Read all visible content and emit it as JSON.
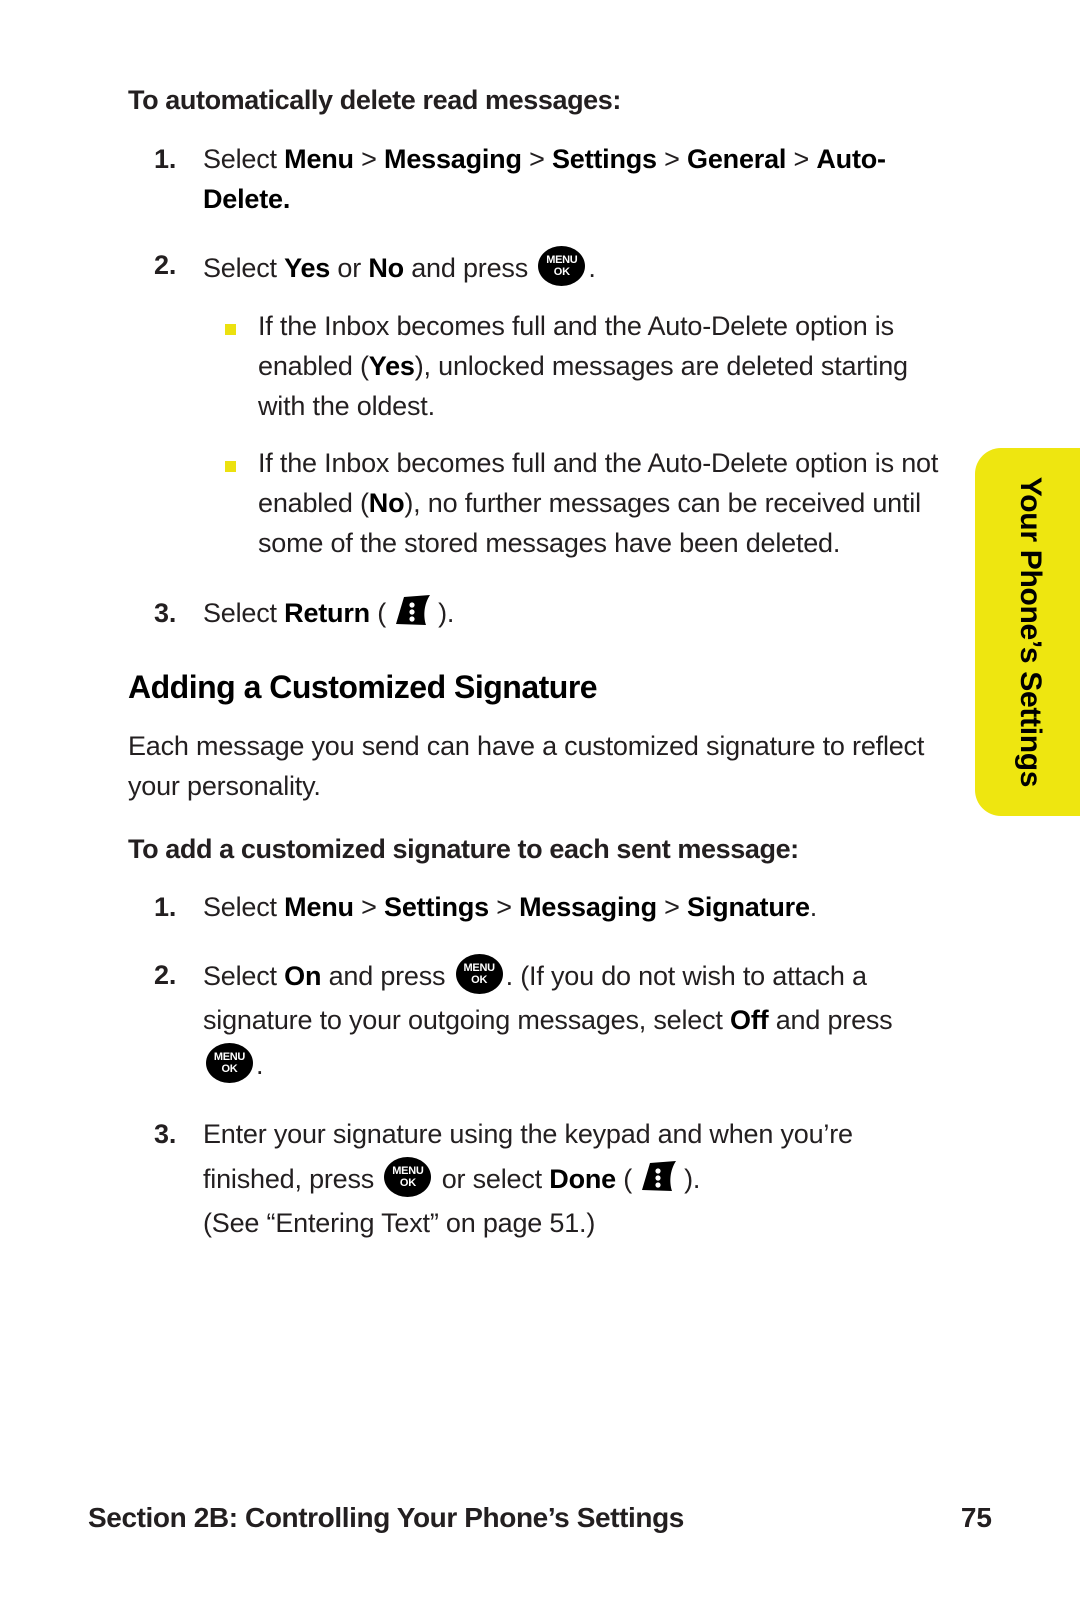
{
  "page": {
    "number": "75",
    "side_tab_label": "Your Phone’s Settings",
    "footer_title": "Section 2B: Controlling Your Phone’s Settings"
  },
  "proc1": {
    "heading": "To automatically delete read messages:",
    "steps": [
      {
        "num": "1.",
        "pre": "Select ",
        "bold1": "Menu",
        "sep1": " > ",
        "bold2": "Messaging",
        "sep2": " > ",
        "bold3": "Settings",
        "sep3": " > ",
        "bold4": "General",
        "sep4": " > ",
        "bold5": "Auto-Delete.",
        "post": ""
      },
      {
        "num": "2.",
        "pre": "Select ",
        "bold1": "Yes",
        "sep1": " or ",
        "bold2": "No",
        "post": " and press ",
        "icon": "menu-ok-button",
        "tail": "."
      },
      {
        "num": "3.",
        "pre": "Select ",
        "bold1": "Return",
        "post": " (",
        "icon": "softkey-button",
        "tail": ")."
      }
    ],
    "bullets": [
      {
        "t1": "If the Inbox becomes full and the Auto-Delete option is enabled (",
        "b1": "Yes",
        "t2": "), unlocked messages are deleted starting with the oldest."
      },
      {
        "t1": "If the Inbox becomes full and the Auto-Delete option is not enabled (",
        "b1": "No",
        "t2": "), no further messages can be received until some of the stored messages have been deleted."
      }
    ]
  },
  "section": {
    "heading": "Adding a Customized Signature",
    "intro": "Each message you send can have a customized signature to reflect your personality."
  },
  "proc2": {
    "heading": "To add a customized signature to each sent message:",
    "steps": [
      {
        "num": "1.",
        "pre": "Select ",
        "bold1": "Menu",
        "sep1": " > ",
        "bold2": "Settings",
        "sep2": " > ",
        "bold3": "Messaging",
        "sep3": " > ",
        "bold4": "Signature",
        "tail": "."
      },
      {
        "num": "2.",
        "pre": "Select ",
        "bold1": "On",
        "mid1": " and press ",
        "mid2": ". (If you do not wish to attach a signature to your outgoing messages, select ",
        "bold2": "Off",
        "mid3": " and press ",
        "tail": "."
      },
      {
        "num": "3.",
        "pre": "Enter your signature using the keypad and when you’re finished, press ",
        "mid1": " or select ",
        "bold1": "Done",
        "mid2": " (",
        "tail": ").",
        "note": "(See “Entering Text” on page 51.)"
      }
    ]
  },
  "icons": {
    "menu_line1": "MENU",
    "menu_line2": "OK"
  },
  "colors": {
    "tab_yellow": "#eee610",
    "bullet_yellow": "#ece10f",
    "text": "#231f20"
  }
}
